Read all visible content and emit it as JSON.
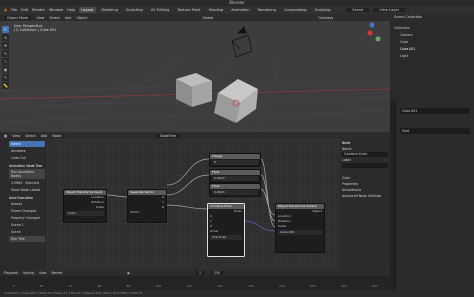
{
  "window": {
    "title": "Blender"
  },
  "menubar": {
    "file_menus": [
      "File",
      "Edit",
      "Render",
      "Window",
      "Help"
    ],
    "workspaces": [
      "Layout",
      "Modeling",
      "Sculpting",
      "UV Editing",
      "Texture Paint",
      "Shading",
      "Animation",
      "Rendering",
      "Compositing",
      "Scripting"
    ],
    "active_workspace": "Layout",
    "scene_name": "Scene",
    "view_layer_name": "View Layer"
  },
  "viewport": {
    "header_items": [
      "Object Mode",
      "View",
      "Select",
      "Add",
      "Object",
      "Global"
    ],
    "overlay_label": "Overlays",
    "info_line1": "User Perspective",
    "info_line2": "(1) Collection | Cube.001"
  },
  "node_editor": {
    "header_items": [
      "View",
      "Select",
      "Add",
      "Node"
    ],
    "tree_name": "NodeTree",
    "sidebar_items": [
      {
        "label": "Select",
        "selected": true
      },
      {
        "label": "Annotate",
        "selected": false
      },
      {
        "label": "Links Cut",
        "selected": false
      }
    ],
    "sidebar_sections": [
      "Animation Node Tree",
      "Auto Execution"
    ],
    "sidebar_labels": [
      "Run Animation Nodes",
      "3.5664 · Selected",
      "Show Node Labels",
      "Always",
      "Frame Changed",
      "Property Changed",
      "Scene 1",
      "Scene",
      "Run Tree"
    ],
    "nodes": [
      {
        "title": "Object Transforms Input",
        "rows": [
          "Location",
          "Rotation",
          "Scale"
        ],
        "field": "Cube"
      },
      {
        "title": "Separate Vector",
        "rows": [
          "X",
          "Y",
          "Z"
        ],
        "field": "Vector"
      },
      {
        "title": "Integer",
        "rows": [
          "0"
        ]
      },
      {
        "title": "Float",
        "rows": [
          "0.0020"
        ]
      },
      {
        "title": "Float",
        "rows": [
          "0.9400"
        ]
      },
      {
        "title": "Combine Euler",
        "rows": [
          "Euler",
          "X",
          "Y",
          "Z",
          "Order"
        ],
        "field": "XYZ Euler"
      },
      {
        "title": "Object Transforms Output",
        "rows": [
          "Object",
          "Location",
          "Rotation",
          "Scale"
        ],
        "field": "Cube.001"
      }
    ],
    "panel": {
      "tab": "Node",
      "name_label": "Name",
      "name_value": "Combine Euler",
      "label_label": "Label",
      "color_label": "Color",
      "properties_label": "Properties",
      "annotations_label": "Annotations",
      "advanced_label": "Advanced Node Settings"
    }
  },
  "timeline": {
    "header_items": [
      "Playback",
      "Keying",
      "View",
      "Marker"
    ],
    "ruler": [
      "0",
      "20",
      "40",
      "60",
      "80",
      "100",
      "120",
      "140",
      "160",
      "180",
      "200",
      "220",
      "240"
    ],
    "start": "1",
    "end": "250"
  },
  "outliner": {
    "title": "Scene Collection",
    "items": [
      "Collection",
      "Camera",
      "Cube",
      "Cube.001",
      "Light"
    ]
  },
  "properties": {
    "object_name": "Cube.001",
    "field_label": "Vset"
  },
  "statusbar": {
    "text": "Collection | Cube.001 | Verts:16 | Faces:12 | Tris:24 | Objects:1/4 | Mem: 22.4 MiB | v2.80.75"
  }
}
